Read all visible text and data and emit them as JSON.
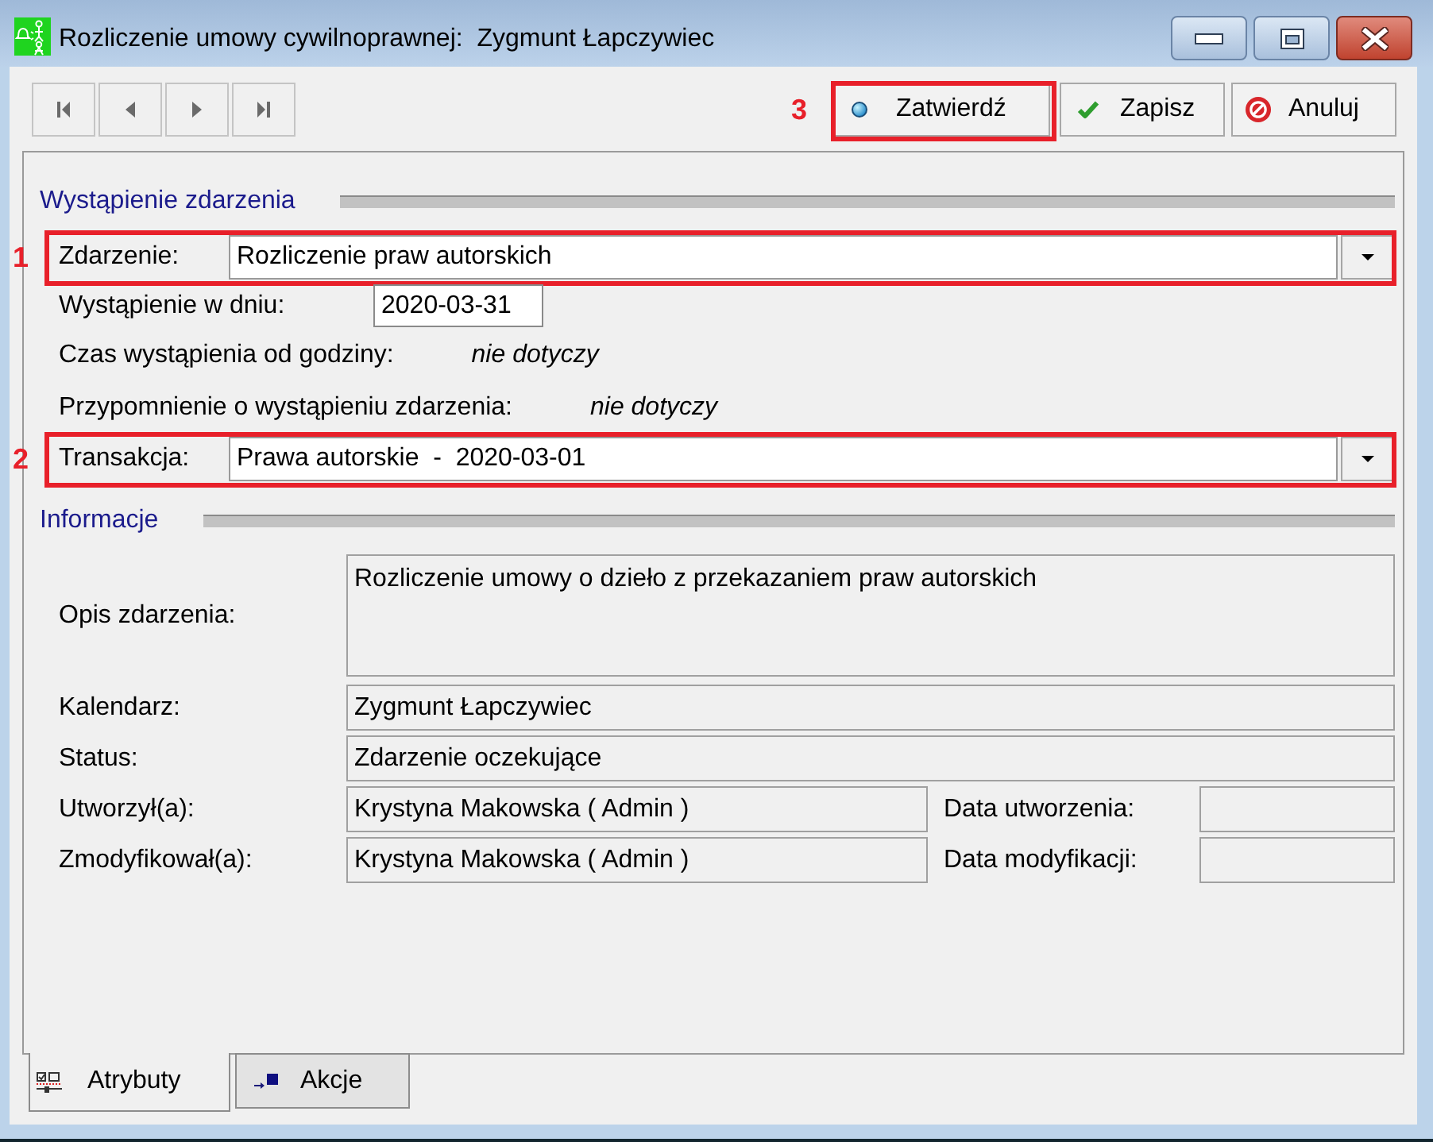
{
  "window": {
    "title": "Rozliczenie umowy cywilnoprawnej:  Zygmunt Łapczywiec"
  },
  "toolbar": {
    "nav_buttons": [
      {
        "kind": "first"
      },
      {
        "kind": "prev"
      },
      {
        "kind": "next"
      },
      {
        "kind": "last"
      }
    ],
    "actions": [
      {
        "kind": "confirm",
        "label": "Zatwierdź",
        "callout": "3"
      },
      {
        "kind": "save",
        "label": "Zapisz"
      },
      {
        "kind": "cancel",
        "label": "Anuluj"
      }
    ]
  },
  "sections": [
    {
      "title": "Wystąpienie zdarzenia",
      "rows": [
        {
          "kind": "combo",
          "label": "Zdarzenie:",
          "value": "Rozliczenie praw autorskich",
          "callout": "1"
        },
        {
          "kind": "date",
          "label": "Wystąpienie w dniu:",
          "value": "2020-03-31"
        },
        {
          "kind": "note",
          "label": "Czas wystąpienia od godziny:",
          "value": "nie dotyczy"
        },
        {
          "kind": "note",
          "label": "Przypomnienie o wystąpieniu zdarzenia:",
          "value": "nie dotyczy"
        },
        {
          "kind": "combo",
          "label": "Transakcja:",
          "value": "Prawa autorskie  -  2020-03-01",
          "callout": "2"
        }
      ]
    },
    {
      "title": "Informacje",
      "rows": [
        {
          "kind": "memo",
          "label": "Opis zdarzenia:",
          "value": "Rozliczenie umowy o dzieło z przekazaniem praw autorskich"
        },
        {
          "kind": "text",
          "label": "Kalendarz:",
          "value": "Zygmunt Łapczywiec"
        },
        {
          "kind": "text",
          "label": "Status:",
          "value": "Zdarzenie oczekujące"
        },
        {
          "kind": "pair",
          "label": "Utworzył(a):",
          "value": "Krystyna Makowska ( Admin )",
          "date_label": "Data utworzenia:"
        },
        {
          "kind": "pair",
          "label": "Zmodyfikował(a):",
          "value": "Krystyna Makowska ( Admin )",
          "date_label": "Data modyfikacji:"
        }
      ]
    }
  ],
  "tabs": [
    {
      "kind": "attributes",
      "label": "Atrybuty",
      "selected": true
    },
    {
      "kind": "actions",
      "label": "Akcje",
      "selected": false
    }
  ]
}
